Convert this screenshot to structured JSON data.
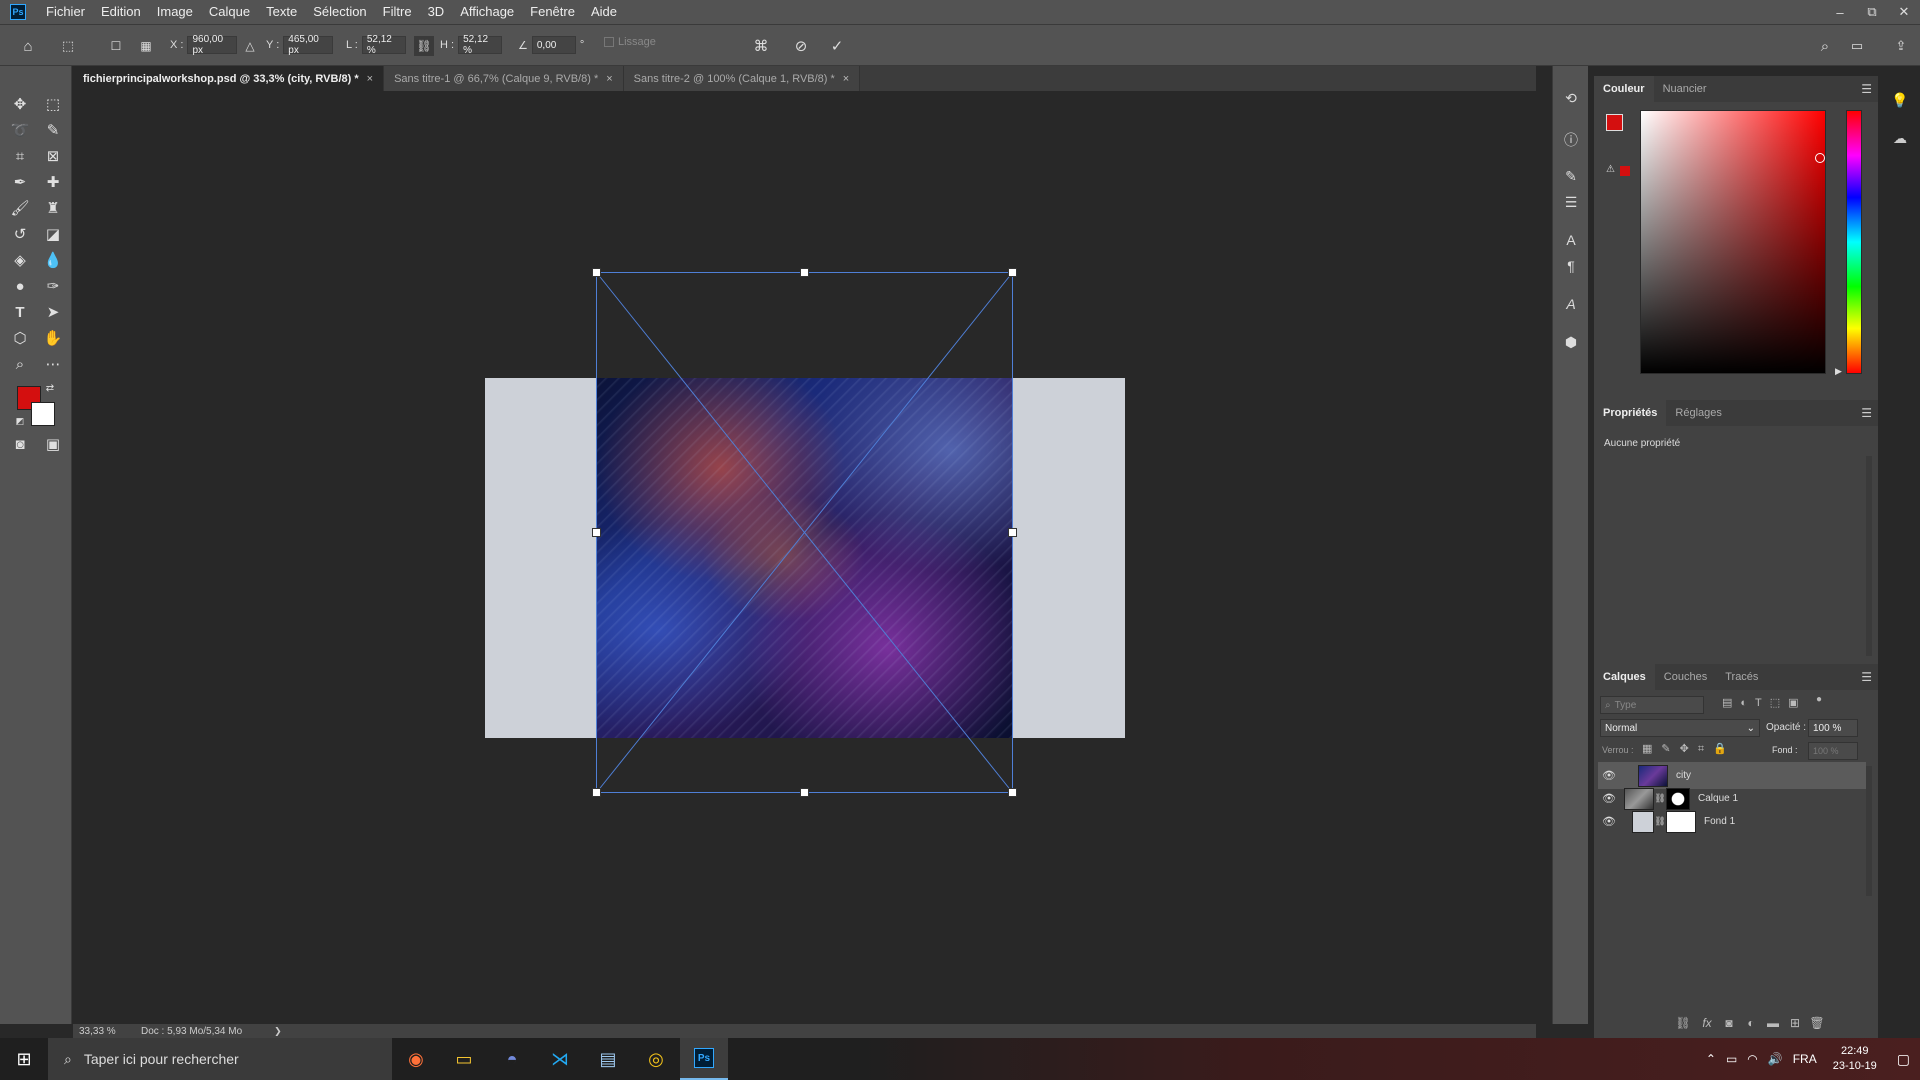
{
  "app": {
    "logo": "Ps",
    "brand_color": "#31a8ff"
  },
  "menu": [
    "Fichier",
    "Edition",
    "Image",
    "Calque",
    "Texte",
    "Sélection",
    "Filtre",
    "3D",
    "Affichage",
    "Fenêtre",
    "Aide"
  ],
  "window_controls": {
    "minimize": "–",
    "restore": "⧉",
    "close": "✕"
  },
  "options": {
    "x_label": "X :",
    "x_value": "960,00 px",
    "y_label": "Y :",
    "y_value": "465,00 px",
    "w_label": "L :",
    "w_value": "52,12 %",
    "h_label": "H :",
    "h_value": "52,12 %",
    "angle_value": "0,00",
    "angle_unit": "°",
    "smoothing_label": "Lissage"
  },
  "tabs": [
    {
      "label": "fichierprincipalworkshop.psd @ 33,3% (city, RVB/8) *",
      "close": "×"
    },
    {
      "label": "Sans titre-1 @ 66,7% (Calque 9, RVB/8) *",
      "close": "×"
    },
    {
      "label": "Sans titre-2 @ 100% (Calque 1, RVB/8) *",
      "close": "×"
    }
  ],
  "colors": {
    "foreground": "#d40f0f",
    "background": "#ffffff",
    "picker_marker": "#d40f0f"
  },
  "color_panel": {
    "tabs": [
      "Couleur",
      "Nuancier"
    ]
  },
  "properties_panel": {
    "tabs": [
      "Propriétés",
      "Réglages"
    ],
    "empty_text": "Aucune propriété"
  },
  "layers_panel": {
    "tabs": [
      "Calques",
      "Couches",
      "Tracés"
    ],
    "filter_placeholder": "Type",
    "blend_mode": "Normal",
    "opacity_label": "Opacité :",
    "opacity_value": "100 %",
    "lock_label": "Verrou :",
    "fill_label": "Fond :",
    "fill_value": "100 %",
    "layers": [
      {
        "name": "city"
      },
      {
        "name": "Calque 1"
      },
      {
        "name": "Fond 1"
      }
    ]
  },
  "status": {
    "zoom": "33,33 %",
    "doc": "Doc : 5,93 Mo/5,34 Mo",
    "arrow": "❯"
  },
  "taskbar": {
    "search_placeholder": "Taper ici pour rechercher",
    "language": "FRA",
    "time": "22:49",
    "date": "23-10-19"
  }
}
